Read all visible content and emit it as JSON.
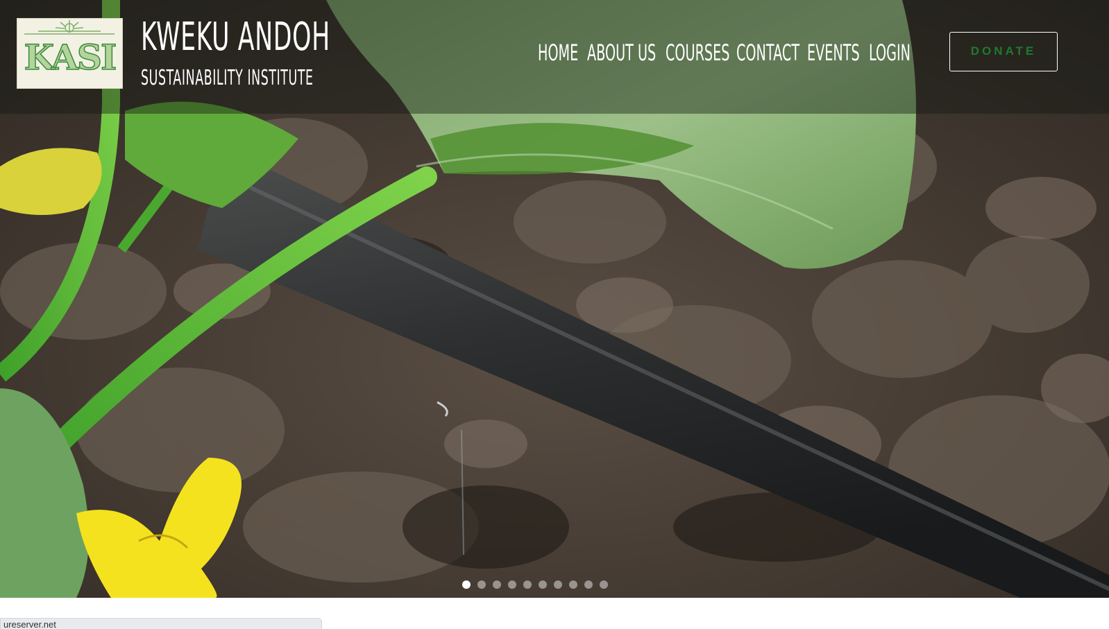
{
  "brand": {
    "logo_text": "KASI",
    "title": "KWEKU ANDOH",
    "subtitle": "SUSTAINABILITY INSTITUTE"
  },
  "nav": {
    "items": [
      {
        "label": "HOME"
      },
      {
        "label": "ABOUT US"
      },
      {
        "label": "COURSES"
      },
      {
        "label": "CONTACT"
      },
      {
        "label": "EVENTS"
      },
      {
        "label": "LOGIN"
      }
    ],
    "donate_label": "DONATE"
  },
  "slider": {
    "slide_count": 10,
    "active_index": 0
  },
  "status_bar": {
    "text": "ureserver.net"
  },
  "colors": {
    "accent_green": "#1f7a2c",
    "logo_green": "#3b8a3a"
  }
}
